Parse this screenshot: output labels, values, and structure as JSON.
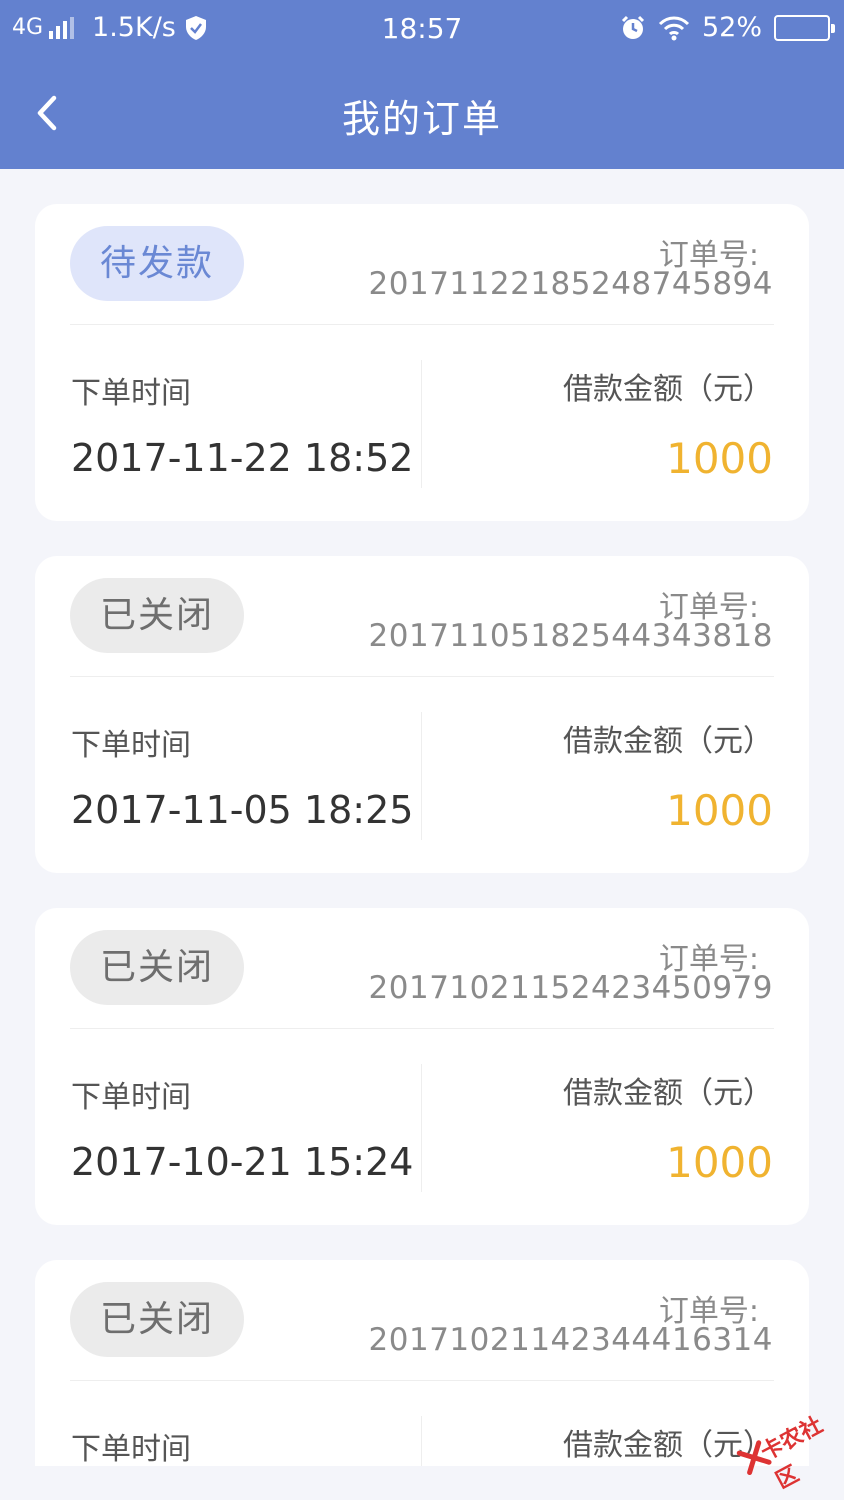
{
  "status_bar": {
    "network": "4G",
    "speed": "1.5K/s",
    "time": "18:57",
    "battery": "52%"
  },
  "header": {
    "title": "我的订单"
  },
  "colors": {
    "header_bg": "#6381cf",
    "amount": "#f0b330",
    "pending_badge_bg": "#dfe5fa",
    "pending_badge_text": "#6a88d4"
  },
  "orders": [
    {
      "status": "待发款",
      "order_label": "订单号:",
      "order_no": "201711221852487458​94",
      "time_label": "下单时间",
      "time": "2017-11-22 18:52",
      "amount_label": "借款金额（元）",
      "amount": "1000"
    },
    {
      "status": "已关闭",
      "order_label": "订单号:",
      "order_no": "20171105182544343818",
      "time_label": "下单时间",
      "time": "2017-11-05 18:25",
      "amount_label": "借款金额（元）",
      "amount": "1000"
    },
    {
      "status": "已关闭",
      "order_label": "订单号:",
      "order_no": "20171021152423450979",
      "time_label": "下单时间",
      "time": "2017-10-21 15:24",
      "amount_label": "借款金额（元）",
      "amount": "1000"
    },
    {
      "status": "已关闭",
      "order_label": "订单号:",
      "order_no": "20171021142344416314",
      "time_label": "下单时间",
      "amount_label": "借款金额（元）"
    }
  ],
  "watermark": "卡农社区"
}
